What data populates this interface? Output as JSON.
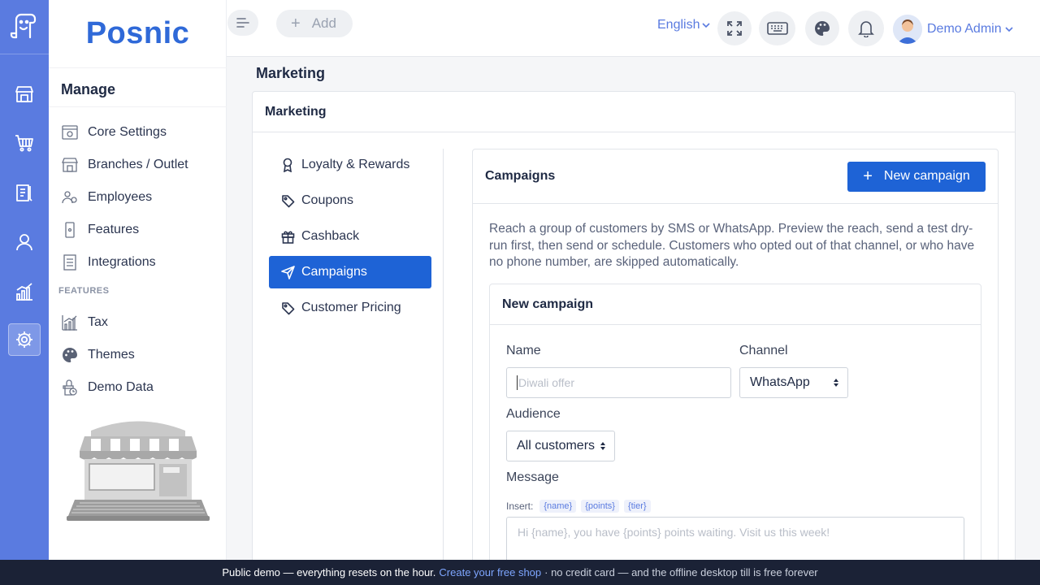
{
  "app": {
    "brand": "Posnic"
  },
  "iconbar": {
    "logo_icon": "app-logo-icon",
    "items": [
      {
        "icon": "store-icon"
      },
      {
        "icon": "cart-icon"
      },
      {
        "icon": "clipboard-icon"
      },
      {
        "icon": "user-icon"
      },
      {
        "icon": "chart-icon"
      },
      {
        "icon": "gear-icon",
        "active": true
      }
    ]
  },
  "sidebar": {
    "section_title": "Manage",
    "items": [
      {
        "label": "Core Settings",
        "icon": "settings-panel-icon"
      },
      {
        "label": "Branches / Outlet",
        "icon": "store-icon"
      },
      {
        "label": "Employees",
        "icon": "employees-icon"
      },
      {
        "label": "Features",
        "icon": "phone-icon"
      },
      {
        "label": "Integrations",
        "icon": "list-icon"
      }
    ],
    "features_label": "FEATURES",
    "feature_items": [
      {
        "label": "Tax",
        "icon": "tax-chart-icon"
      },
      {
        "label": "Themes",
        "icon": "palette-icon"
      },
      {
        "label": "Demo Data",
        "icon": "demo-data-icon"
      }
    ]
  },
  "topbar": {
    "add_label": "Add",
    "language": "English",
    "user_name": "Demo Admin"
  },
  "page": {
    "title": "Marketing"
  },
  "card": {
    "title": "Marketing"
  },
  "subnav": [
    {
      "label": "Loyalty & Rewards",
      "icon": "award-icon"
    },
    {
      "label": "Coupons",
      "icon": "tag-icon"
    },
    {
      "label": "Cashback",
      "icon": "gift-icon"
    },
    {
      "label": "Campaigns",
      "icon": "send-icon",
      "active": true
    },
    {
      "label": "Customer Pricing",
      "icon": "tag-icon"
    }
  ],
  "campaigns": {
    "title": "Campaigns",
    "new_button": "New campaign",
    "description": "Reach a group of customers by SMS or WhatsApp. Preview the reach, send a test dry-run first, then send or schedule. Customers who opted out of that channel, or who have no phone number, are skipped automatically.",
    "form": {
      "title": "New campaign",
      "name_label": "Name",
      "name_placeholder": "Diwali offer",
      "channel_label": "Channel",
      "channel_value": "WhatsApp",
      "audience_label": "Audience",
      "audience_value": "All customers",
      "message_label": "Message",
      "insert_label": "Insert:",
      "tags": [
        "{name}",
        "{points}",
        "{tier}"
      ],
      "message_placeholder": "Hi {name}, you have {points} points waiting. Visit us this week!"
    }
  },
  "footer": {
    "text": "Public demo — everything resets on the hour.",
    "link": "Create your free shop",
    "rest": "· no credit card — and the offline desktop till is free forever"
  },
  "colors": {
    "accent": "#1e63d6",
    "iconbar": "#5a7be0",
    "footer": "#1b2236"
  }
}
